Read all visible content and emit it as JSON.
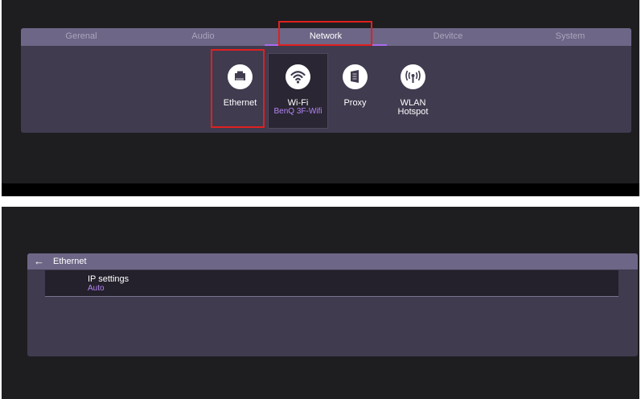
{
  "settings": {
    "tabs": [
      {
        "label": "Gerenal"
      },
      {
        "label": "Audio"
      },
      {
        "label": "Network"
      },
      {
        "label": "Devitce"
      },
      {
        "label": "System"
      }
    ],
    "active_tab": "Network",
    "network_options": [
      {
        "label": "Ethernet",
        "icon": "ethernet-icon"
      },
      {
        "label": "Wi-Fi",
        "sublabel": "BenQ 3F-Wifi",
        "icon": "wifi-icon"
      },
      {
        "label": "Proxy",
        "icon": "proxy-icon"
      },
      {
        "label": "WLAN Hotspot",
        "line1": "WLAN",
        "line2": "Hotspot",
        "icon": "hotspot-icon"
      }
    ]
  },
  "ethernet": {
    "title": "Ethernet",
    "back_icon": "back-arrow-icon",
    "ip_settings": {
      "label": "IP settings",
      "value": "Auto"
    }
  },
  "colors": {
    "background": "#1e1e21",
    "panel": "#403b4f",
    "tabbar": "#6d6686",
    "accent": "#a86bef",
    "highlight": "#e02020"
  }
}
